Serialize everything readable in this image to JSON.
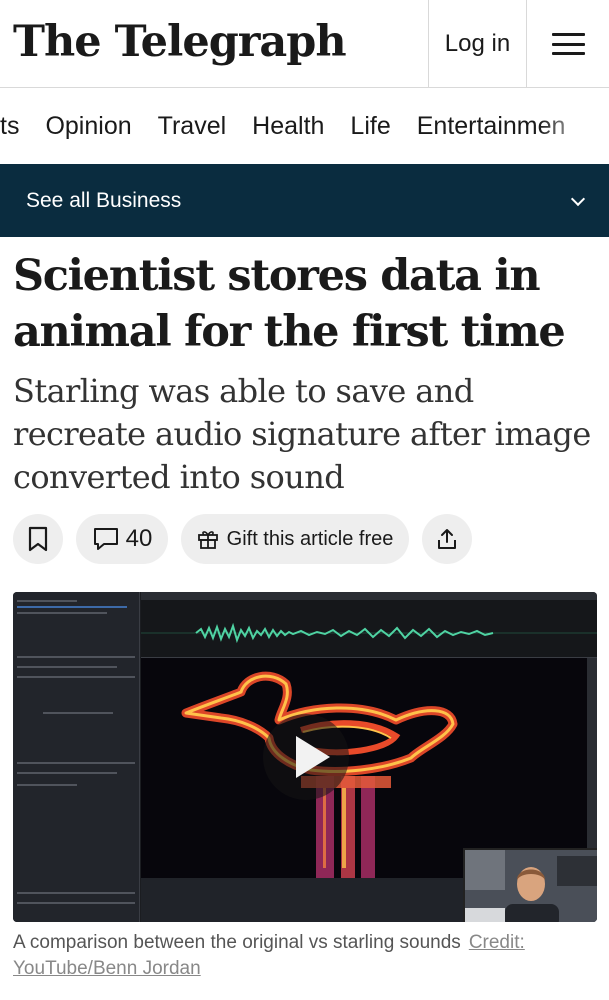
{
  "header": {
    "logo": "The Telegraph",
    "login_label": "Log in",
    "menu_icon": "hamburger-menu-icon"
  },
  "nav": {
    "items": [
      {
        "label": "ts"
      },
      {
        "label": "Opinion"
      },
      {
        "label": "Travel"
      },
      {
        "label": "Health"
      },
      {
        "label": "Life"
      },
      {
        "label": "Entertainmen"
      }
    ]
  },
  "section": {
    "label": "See all Business",
    "icon": "chevron-down-icon",
    "background": "#0a2c3f"
  },
  "article": {
    "headline": "Scientist stores data in animal for the first time",
    "standfirst": "Starling was able to save and recreate audio signature after image converted into sound",
    "actions": {
      "bookmark_icon": "bookmark-icon",
      "comment_icon": "comment-icon",
      "comment_count": "40",
      "gift_icon": "gift-icon",
      "gift_label": "Gift this article free",
      "share_icon": "share-icon"
    },
    "media": {
      "type": "video",
      "play_icon": "play-icon"
    },
    "caption": {
      "text": "A comparison between the original vs starling sounds",
      "credit": "Credit: YouTube/Benn Jordan"
    }
  }
}
